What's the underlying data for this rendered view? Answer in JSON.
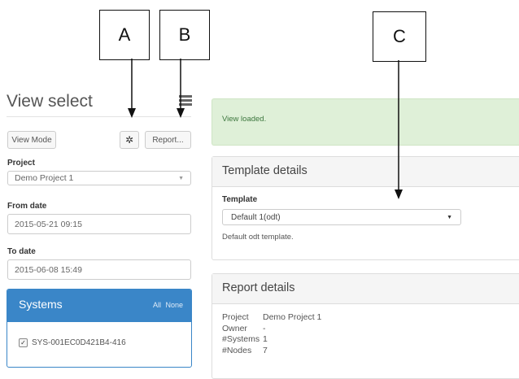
{
  "callouts": {
    "a": "A",
    "b": "B",
    "c": "C"
  },
  "sidebar": {
    "title": "View select",
    "list_icon": "list-icon",
    "view_mode_label": "View Mode",
    "settings_icon": "gear-icon",
    "report_label": "Report...",
    "project": {
      "label": "Project",
      "value": "Demo Project 1"
    },
    "from_date": {
      "label": "From date",
      "value": "2015-05-21 09:15"
    },
    "to_date": {
      "label": "To date",
      "value": "2015-06-08 15:49"
    },
    "systems": {
      "title": "Systems",
      "all_label": "All",
      "none_label": "None",
      "items": [
        {
          "label": "SYS-001EC0D421B4-416",
          "checked": true
        }
      ]
    }
  },
  "alert": {
    "text": "View loaded."
  },
  "template_details": {
    "title": "Template details",
    "template_label": "Template",
    "template_value": "Default 1(odt)",
    "description": "Default odt template."
  },
  "report_details": {
    "title": "Report details",
    "rows": [
      {
        "key": "Project",
        "value": "Demo Project 1"
      },
      {
        "key": "Owner",
        "value": "-"
      },
      {
        "key": "#Systems",
        "value": "1"
      },
      {
        "key": "#Nodes",
        "value": "7"
      }
    ]
  },
  "colors": {
    "systems_header": "#3a86c8",
    "alert_background": "#dff0d8",
    "alert_text": "#3c763d"
  }
}
